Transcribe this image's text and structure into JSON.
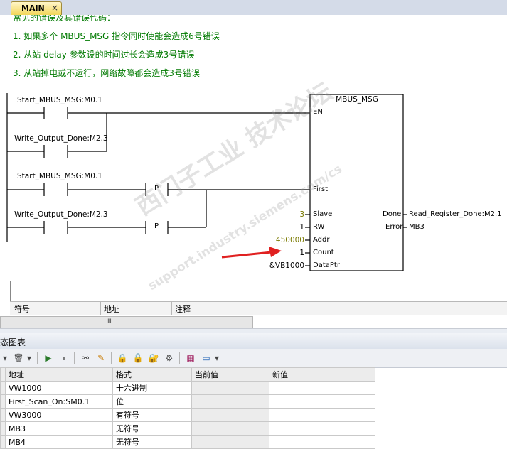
{
  "tab": {
    "label": "MAIN",
    "close": "×"
  },
  "comments": [
    "常见的错误及其错误代码：",
    "1. 如果多个 MBUS_MSG 指令同时使能会造成6号错误",
    "2. 从站 delay 参数设的时间过长会造成3号错误",
    "3. 从站掉电或不运行，网络故障都会造成3号错误"
  ],
  "ladder": {
    "contacts": [
      {
        "label": "Start_MBUS_MSG:M0.1"
      },
      {
        "label": "Write_Output_Done:M2.3"
      },
      {
        "label": "Start_MBUS_MSG:M0.1"
      },
      {
        "label": "Write_Output_Done:M2.3"
      }
    ],
    "edge_label": "P",
    "block": {
      "title": "MBUS_MSG",
      "inputs": [
        {
          "pin": "EN",
          "value": ""
        },
        {
          "pin": "First",
          "value": ""
        },
        {
          "pin": "Slave",
          "value": "3"
        },
        {
          "pin": "RW",
          "value": "1"
        },
        {
          "pin": "Addr",
          "value": "450000"
        },
        {
          "pin": "Count",
          "value": "1"
        },
        {
          "pin": "DataPtr",
          "value": "&VB1000"
        }
      ],
      "outputs": [
        {
          "pin": "Done",
          "value": "Read_Register_Done:M2.1"
        },
        {
          "pin": "Error",
          "value": "MB3"
        }
      ]
    }
  },
  "watermark": {
    "cn": "西门子工业  技术论坛",
    "url": "support.industry.siemens.com/cs"
  },
  "symbol_table": {
    "headers": [
      "符号",
      "地址",
      "注释"
    ],
    "scroll_glyph": "III"
  },
  "status_panel": {
    "title": "态图表",
    "columns": [
      "地址",
      "格式",
      "当前值",
      "新值"
    ],
    "rows": [
      {
        "address": "VW1000",
        "format": "十六进制",
        "current": "",
        "new": ""
      },
      {
        "address": "First_Scan_On:SM0.1",
        "format": "位",
        "current": "",
        "new": ""
      },
      {
        "address": "VW3000",
        "format": "有符号",
        "current": "",
        "new": ""
      },
      {
        "address": "MB3",
        "format": "无符号",
        "current": "",
        "new": ""
      },
      {
        "address": "MB4",
        "format": "无符号",
        "current": "",
        "new": ""
      }
    ]
  },
  "colors": {
    "comment": "#007a00",
    "arrow": "#e02020",
    "tab": "#f3d65a"
  }
}
